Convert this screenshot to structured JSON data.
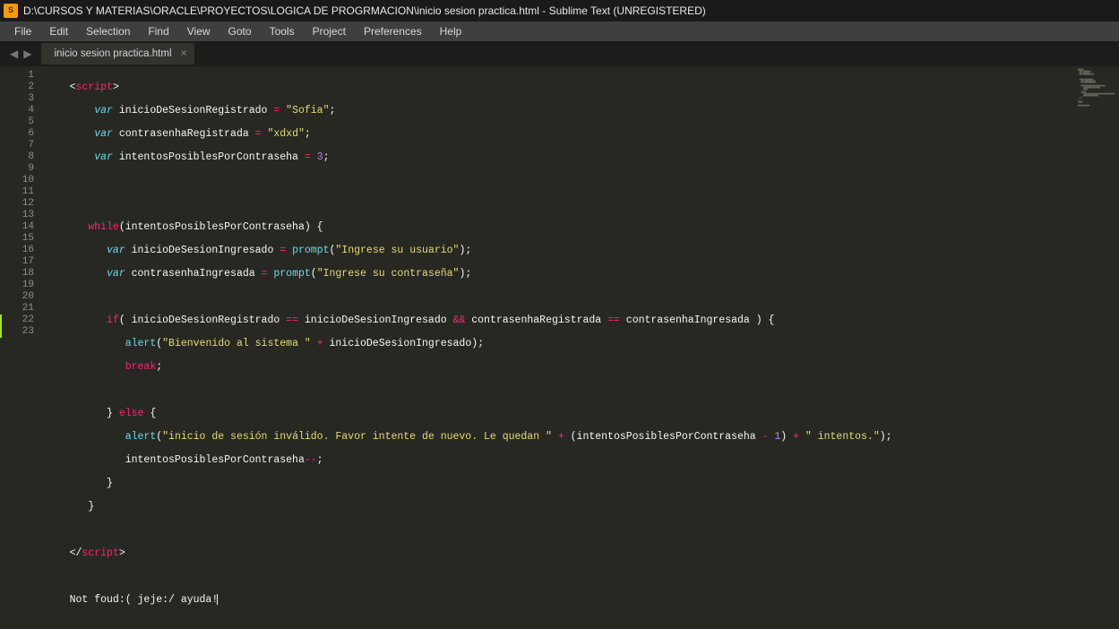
{
  "titlebar": {
    "logo": "S",
    "title": "D:\\CURSOS Y MATERIAS\\ORACLE\\PROYECTOS\\LOGICA DE PROGRMACION\\inicio sesion practica.html - Sublime Text (UNREGISTERED)"
  },
  "menu": {
    "items": [
      "File",
      "Edit",
      "Selection",
      "Find",
      "View",
      "Goto",
      "Tools",
      "Project",
      "Preferences",
      "Help"
    ]
  },
  "tabs": {
    "nav_left": "◀",
    "nav_right": "▶",
    "open": [
      {
        "name": "inicio sesion practica.html",
        "close": "×"
      }
    ]
  },
  "editor": {
    "line_count": 23,
    "modified_lines": [
      22,
      23
    ],
    "tokens": {
      "l1": {
        "a": "<",
        "b": "script",
        "c": ">"
      },
      "l2": {
        "a": "var ",
        "b": "inicioDeSesionRegistrado ",
        "c": "= ",
        "d": "\"Sofia\"",
        "e": ";"
      },
      "l3": {
        "a": "var ",
        "b": "contrasenhaRegistrada ",
        "c": "= ",
        "d": "\"xdxd\"",
        "e": ";"
      },
      "l4": {
        "a": "var ",
        "b": "intentosPosiblesPorContraseha ",
        "c": "= ",
        "d": "3",
        "e": ";"
      },
      "l7": {
        "a": "while",
        "b": "(intentosPosiblesPorContraseha) {"
      },
      "l8": {
        "a": "var ",
        "b": "inicioDeSesionIngresado ",
        "c": "= ",
        "d": "prompt",
        "e": "(",
        "f": "\"Ingrese su usuario\"",
        "g": ");"
      },
      "l9": {
        "a": "var ",
        "b": "contrasenhaIngresada ",
        "c": "= ",
        "d": "prompt",
        "e": "(",
        "f": "\"Ingrese su contraseña\"",
        "g": ");"
      },
      "l11": {
        "a": "if",
        "b": "( inicioDeSesionRegistrado ",
        "c": "== ",
        "d": "inicioDeSesionIngresado ",
        "e": "&& ",
        "f": "contrasenhaRegistrada ",
        "g": "== ",
        "h": "contrasenhaIngresada ) {"
      },
      "l12": {
        "a": "alert",
        "b": "(",
        "c": "\"Bienvenido al sistema \"",
        "d": " + ",
        "e": "inicioDeSesionIngresado);"
      },
      "l13": {
        "a": "break",
        "b": ";"
      },
      "l15": {
        "a": "} ",
        "b": "else ",
        "c": "{"
      },
      "l16": {
        "a": "alert",
        "b": "(",
        "c": "\"inicio de sesión inválido. Favor intente de nuevo. Le quedan \"",
        "d": " + ",
        "e": "(intentosPosiblesPorContraseha ",
        "f": "- ",
        "g": "1",
        "h": ") ",
        "i": "+ ",
        "j": "\" intentos.\"",
        "k": ");"
      },
      "l17": {
        "a": "intentosPosiblesPorContraseha",
        "b": "--",
        "c": ";"
      },
      "l18": {
        "a": "}"
      },
      "l19": {
        "a": "}"
      },
      "l21": {
        "a": "</",
        "b": "script",
        "c": ">"
      },
      "l23": {
        "a": "Not foud:( jeje:/ ayuda!"
      }
    }
  },
  "lineNumbers": [
    "1",
    "2",
    "3",
    "4",
    "5",
    "6",
    "7",
    "8",
    "9",
    "10",
    "11",
    "12",
    "13",
    "14",
    "15",
    "16",
    "17",
    "18",
    "19",
    "20",
    "21",
    "22",
    "23"
  ]
}
